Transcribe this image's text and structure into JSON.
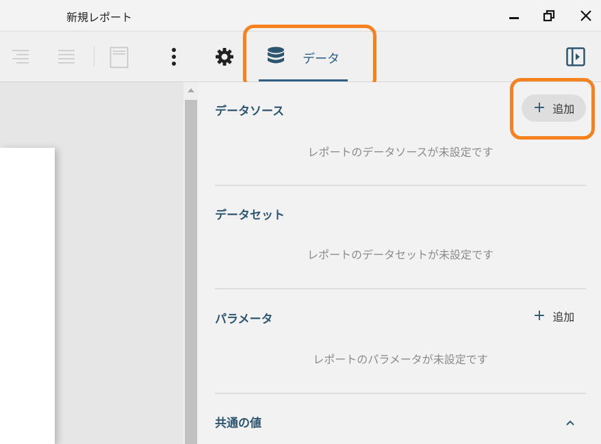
{
  "window": {
    "title": "新規レポート",
    "controls": [
      "minimize-icon",
      "restore-icon",
      "close-icon"
    ]
  },
  "toolbar": {
    "items": [
      "align-right-icon",
      "align-justify-icon",
      "page-icon",
      "more-vertical-icon",
      "gear-icon"
    ],
    "active_tab": {
      "label": "データ",
      "icon": "database-icon"
    },
    "panel_toggle_icon": "panel-toggle-icon"
  },
  "panel": {
    "data_sources": {
      "title": "データソース",
      "add_label": "追加",
      "empty_text": "レポートのデータソースが未設定です"
    },
    "datasets": {
      "title": "データセット",
      "empty_text": "レポートのデータセットが未設定です"
    },
    "parameters": {
      "title": "パラメータ",
      "add_label": "追加",
      "empty_text": "レポートのパラメータが未設定です"
    },
    "common_values": {
      "title": "共通の値",
      "expanded_icon": "chevron-up-icon"
    }
  },
  "colors": {
    "accent": "#2d5570",
    "highlight": "#f5821f",
    "tab_underline": "#2e5f80"
  }
}
